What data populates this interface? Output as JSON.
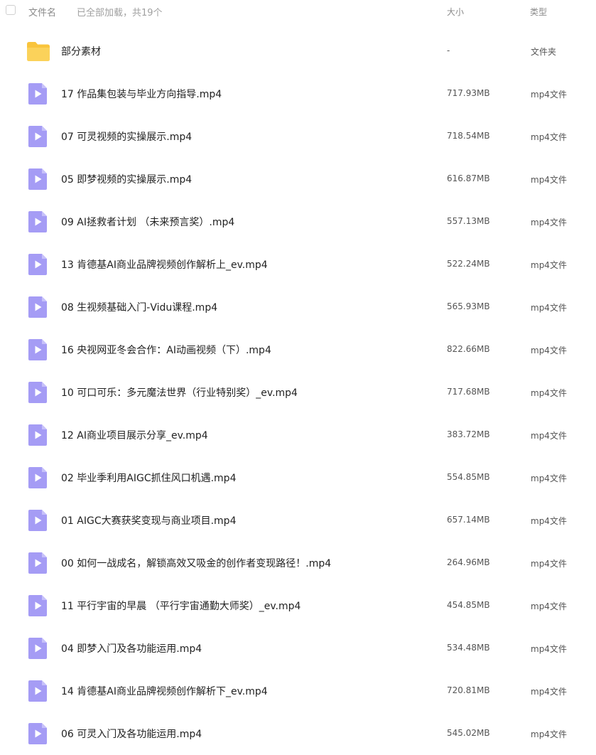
{
  "header": {
    "col_name": "文件名",
    "load_info": "已全部加载，共19个",
    "col_size": "大小",
    "col_type": "类型"
  },
  "colors": {
    "folder": "#f9c43c",
    "video_icon": "#a59cf5"
  },
  "files": [
    {
      "name": "部分素材",
      "size": "-",
      "type": "文件夹",
      "icon": "folder-icon"
    },
    {
      "name": "17 作品集包装与毕业方向指导.mp4",
      "size": "717.93MB",
      "type": "mp4文件",
      "icon": "video-file-icon"
    },
    {
      "name": "07 可灵视频的实操展示.mp4",
      "size": "718.54MB",
      "type": "mp4文件",
      "icon": "video-file-icon"
    },
    {
      "name": "05 即梦视频的实操展示.mp4",
      "size": "616.87MB",
      "type": "mp4文件",
      "icon": "video-file-icon"
    },
    {
      "name": "09 AI拯救者计划 （未来预言奖）.mp4",
      "size": "557.13MB",
      "type": "mp4文件",
      "icon": "video-file-icon"
    },
    {
      "name": "13 肯德基AI商业品牌视频创作解析上_ev.mp4",
      "size": "522.24MB",
      "type": "mp4文件",
      "icon": "video-file-icon"
    },
    {
      "name": "08 生视频基础入门-Vidu课程.mp4",
      "size": "565.93MB",
      "type": "mp4文件",
      "icon": "video-file-icon"
    },
    {
      "name": "16 央视网亚冬会合作：AI动画视频（下）.mp4",
      "size": "822.66MB",
      "type": "mp4文件",
      "icon": "video-file-icon"
    },
    {
      "name": "10 可口可乐：多元魔法世界（行业特别奖）_ev.mp4",
      "size": "717.68MB",
      "type": "mp4文件",
      "icon": "video-file-icon"
    },
    {
      "name": "12 AI商业项目展示分享_ev.mp4",
      "size": "383.72MB",
      "type": "mp4文件",
      "icon": "video-file-icon"
    },
    {
      "name": "02 毕业季利用AIGC抓住风口机遇.mp4",
      "size": "554.85MB",
      "type": "mp4文件",
      "icon": "video-file-icon"
    },
    {
      "name": "01 AIGC大赛获奖变现与商业项目.mp4",
      "size": "657.14MB",
      "type": "mp4文件",
      "icon": "video-file-icon"
    },
    {
      "name": "00 如何一战成名，解锁高效又吸金的创作者变现路径！.mp4",
      "size": "264.96MB",
      "type": "mp4文件",
      "icon": "video-file-icon"
    },
    {
      "name": "11 平行宇宙的早晨 （平行宇宙通勤大师奖）_ev.mp4",
      "size": "454.85MB",
      "type": "mp4文件",
      "icon": "video-file-icon"
    },
    {
      "name": "04 即梦入门及各功能运用.mp4",
      "size": "534.48MB",
      "type": "mp4文件",
      "icon": "video-file-icon"
    },
    {
      "name": "14 肯德基AI商业品牌视频创作解析下_ev.mp4",
      "size": "720.81MB",
      "type": "mp4文件",
      "icon": "video-file-icon"
    },
    {
      "name": "06 可灵入门及各功能运用.mp4",
      "size": "545.02MB",
      "type": "mp4文件",
      "icon": "video-file-icon"
    }
  ]
}
